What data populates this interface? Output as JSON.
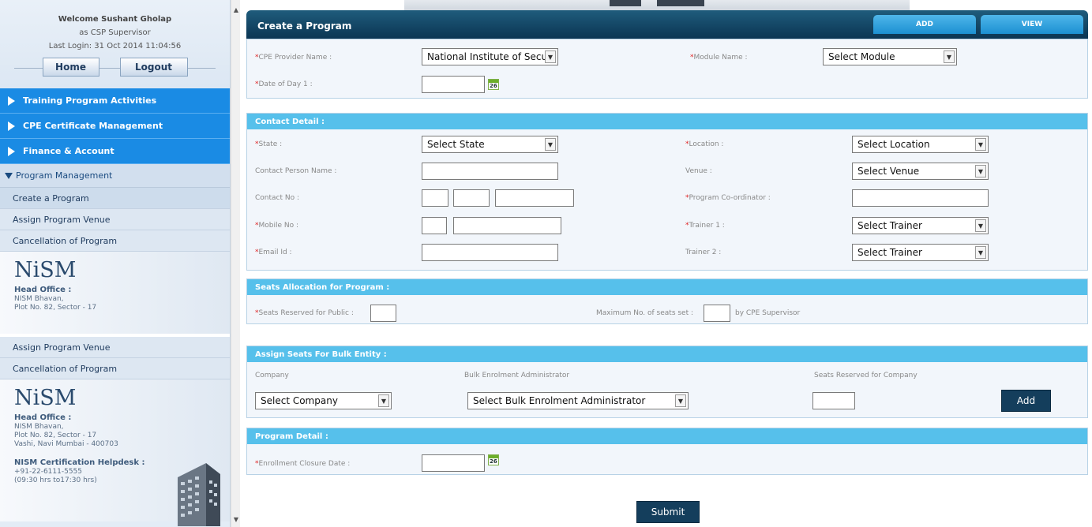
{
  "sidebar": {
    "welcome_line": "Welcome Sushant Gholap",
    "role_line": "as CSP Supervisor",
    "last_login": "Last Login: 31 Oct 2014 11:04:56",
    "home_label": "Home",
    "logout_label": "Logout",
    "menu": [
      {
        "label": "Training Program Activities"
      },
      {
        "label": "CPE Certificate Management"
      },
      {
        "label": "Finance & Account"
      }
    ],
    "open_menu": "Program Management",
    "sub_items": [
      "Create a Program",
      "Assign Program Venue",
      "Cancellation of Program"
    ],
    "sub_items_2": [
      "Assign Program Venue",
      "Cancellation of Program"
    ],
    "logo_text": "NiSM",
    "head_office_title": "Head Office :",
    "addr1": "NISM Bhavan,",
    "addr2": "Plot No. 82, Sector - 17",
    "addr3": "Vashi, Navi Mumbai - 400703",
    "helpdesk_title": "NISM Certification Helpdesk :",
    "helpdesk_phone": "+91-22-6111-5555",
    "helpdesk_hours": "(09:30 hrs to17:30 hrs)"
  },
  "header": {
    "title": "Create a Program",
    "tab_add": "ADD",
    "tab_view": "VIEW"
  },
  "program": {
    "cpe_provider_label": "CPE Provider Name :",
    "cpe_provider_value": "National Institute of Securi",
    "module_label": "Module Name :",
    "module_value": "Select Module",
    "date_day1_label": "Date of Day 1 :"
  },
  "contact": {
    "header": "Contact Detail :",
    "state_label": "State :",
    "state_value": "Select State",
    "location_label": "Location :",
    "location_value": "Select Location",
    "contact_person_label": "Contact Person Name :",
    "venue_label": "Venue :",
    "venue_value": "Select Venue",
    "contact_no_label": "Contact No :",
    "coordinator_label": "Program Co-ordinator :",
    "mobile_label": "Mobile No :",
    "trainer1_label": "Trainer 1 :",
    "trainer1_value": "Select Trainer",
    "email_label": "Email Id :",
    "trainer2_label": "Trainer 2 :",
    "trainer2_value": "Select Trainer"
  },
  "seats": {
    "header": "Seats Allocation for Program :",
    "public_label": "Seats Reserved for Public :",
    "max_label": "Maximum No. of seats set :",
    "max_suffix": "by CPE Supervisor"
  },
  "bulk": {
    "header": "Assign Seats For Bulk Entity :",
    "company_label": "Company",
    "admin_label": "Bulk Enrolment Administrator",
    "reserved_label": "Seats Reserved for Company",
    "company_value": "Select Company",
    "admin_value": "Select Bulk Enrolment Administrator",
    "add_label": "Add"
  },
  "detail": {
    "header": "Program Detail :",
    "closure_label": "Enrollment Closure Date :"
  },
  "submit_label": "Submit",
  "colors": {
    "title_bar": "#0b3553",
    "tab": "#1c90d2",
    "section_header": "#56c0eb",
    "menu_blue": "#1a8be4",
    "button_dark": "#143e5c",
    "required": "#e02020"
  }
}
